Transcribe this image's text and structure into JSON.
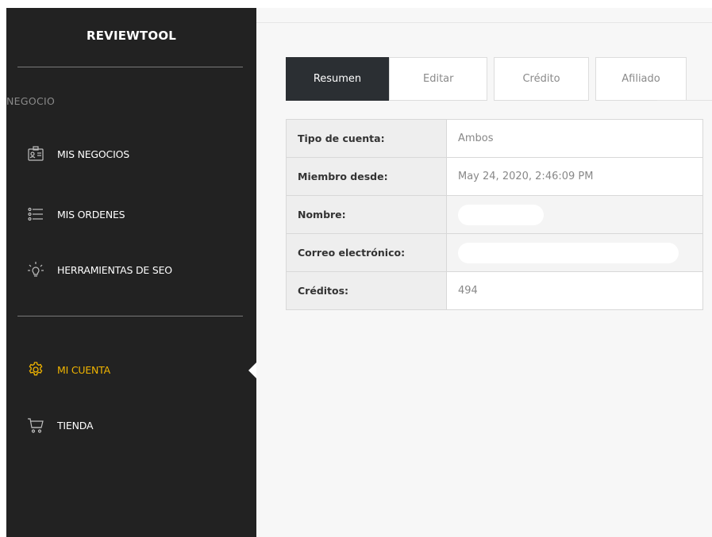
{
  "app": {
    "brand": "REVIEWTOOL"
  },
  "sidebar": {
    "section_label": "NEGOCIO",
    "items": [
      {
        "label": "MIS NEGOCIOS",
        "icon": "id-card-icon"
      },
      {
        "label": "MIS ORDENES",
        "icon": "list-icon"
      },
      {
        "label": "HERRAMIENTAS DE SEO",
        "icon": "lightbulb-icon"
      },
      {
        "label": "MI CUENTA",
        "icon": "gear-icon",
        "active": true
      },
      {
        "label": "TIENDA",
        "icon": "cart-icon"
      }
    ],
    "colors": {
      "background": "#222222",
      "active": "#f0b400",
      "text": "#ffffff"
    }
  },
  "tabs": [
    {
      "label": "Resumen",
      "active": true
    },
    {
      "label": "Editar",
      "active": false
    },
    {
      "label": "Crédito",
      "active": false
    },
    {
      "label": "Afiliado",
      "active": false
    }
  ],
  "account": {
    "rows": [
      {
        "key": "Tipo de cuenta:",
        "value": "Ambos"
      },
      {
        "key": "Miembro desde:",
        "value": "May 24, 2020, 2:46:09 PM"
      },
      {
        "key": "Nombre:",
        "value": ""
      },
      {
        "key": "Correo electrónico:",
        "value": ""
      },
      {
        "key": "Créditos:",
        "value": "494"
      }
    ]
  }
}
